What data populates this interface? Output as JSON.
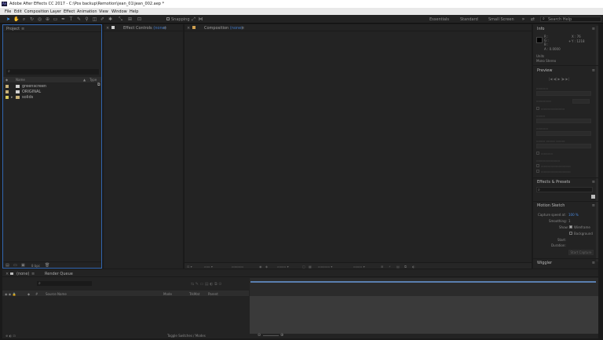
{
  "window": {
    "title": "Adobe After Effects CC 2017 - C:\\Pos backup\\Remotion\\jean_01\\jean_002.aep *"
  },
  "menu": [
    "File",
    "Edit",
    "Composition",
    "Layer",
    "Effect",
    "Animation",
    "View",
    "Window",
    "Help"
  ],
  "toolbar": {
    "snapping_label": "Snapping",
    "workspaces": [
      "Essentials",
      "Standard",
      "Small Screen"
    ],
    "search_placeholder": "Search Help"
  },
  "project_panel": {
    "title": "Project",
    "search_icon": "search-icon",
    "columns": {
      "name": "Name",
      "type": "Type"
    },
    "items": [
      {
        "name": "greenscreen",
        "label_color": "#c8b27a",
        "kind": "file"
      },
      {
        "name": "ORIGINAL",
        "label_color": "#c8b27a",
        "kind": "file"
      },
      {
        "name": "solids",
        "label_color": "#d8c95a",
        "kind": "folder"
      }
    ],
    "bpc": "8 bpc"
  },
  "effect_controls": {
    "title": "Effect Controls",
    "value": "(none)"
  },
  "composition": {
    "title": "Composition",
    "value": "(none)"
  },
  "info_panel": {
    "title": "Info",
    "r": "R :",
    "g": "G :",
    "b": "B :",
    "a": "A : 0.0000",
    "x": "X : 76",
    "y": "Y : 1218",
    "units": "Units",
    "mode": "Mono Stereo"
  },
  "preview_panel": {
    "title": "Preview"
  },
  "effects_presets": {
    "title": "Effects & Presets",
    "search_icon": "search-icon"
  },
  "motion_sketch": {
    "title": "Motion Sketch",
    "capture_label": "Capture speed at:",
    "capture_value": "100 %",
    "smoothing_label": "Smoothing:",
    "smoothing_value": "1",
    "show_label": "Show:",
    "wireframe": "Wireframe",
    "background": "Background",
    "start_label": "Start:",
    "duration_label": "Duration:",
    "start_capture": "Start Capture"
  },
  "wiggler": {
    "title": "Wiggler"
  },
  "timeline": {
    "tab_none": "(none)",
    "tab_render": "Render Queue",
    "columns": {
      "source": "Source Name",
      "mode": "Mode",
      "trkmat": "TrkMat",
      "parent": "Parent"
    },
    "toggle": "Toggle Switches / Modes"
  }
}
